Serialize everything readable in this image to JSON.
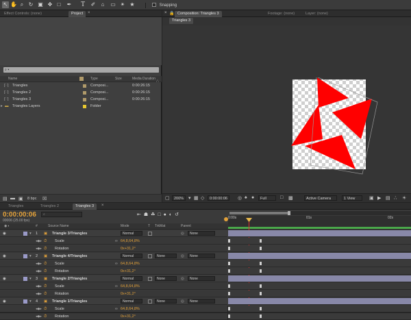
{
  "toolbar": {
    "tools": [
      "selection-tool",
      "hand-tool",
      "zoom-tool",
      "rotation-tool",
      "camera-tool",
      "pan-behind-tool",
      "rectangle-tool",
      "pen-tool",
      "text-tool",
      "brush-tool",
      "clone-stamp-tool",
      "eraser-tool",
      "roto-brush-tool",
      "puppet-tool"
    ],
    "snapping_label": "Snapping"
  },
  "left_panel": {
    "tabs": [
      "Effect Controls: (none)",
      "Project"
    ],
    "search_placeholder": "⌕ ▾",
    "columns": {
      "name": "Name",
      "type": "Type",
      "size": "Size",
      "media_duration": "Media Duration"
    },
    "items": [
      {
        "name": "Triangles",
        "type": "Composi...",
        "size": "",
        "duration": "0:00:26:15",
        "color": "#b09a6a",
        "kind": "comp"
      },
      {
        "name": "Triangles 2",
        "type": "Composi...",
        "size": "",
        "duration": "0:00:26:15",
        "color": "#b09a6a",
        "kind": "comp"
      },
      {
        "name": "Triangles 3",
        "type": "Composi...",
        "size": "",
        "duration": "0:00:26:15",
        "color": "#b09a6a",
        "kind": "comp"
      },
      {
        "name": "Triangles Layers",
        "type": "Folder",
        "size": "",
        "duration": "",
        "color": "#e8c830",
        "kind": "folder"
      }
    ],
    "bit_depth": "8 bpc"
  },
  "comp_panel": {
    "tabs": [
      "Composition: Triangles 3",
      "Footage: (none)",
      "Layer: (none)"
    ],
    "sub_tab": "Triangles 3",
    "zoom": "200%",
    "timecode": "0:00:00:06",
    "resolution": "Full",
    "camera": "Active Camera",
    "view": "1 View",
    "shape_color": "#ff0000"
  },
  "timeline": {
    "tabs": [
      "Triangles",
      "Triangles 2",
      "Triangles 3"
    ],
    "current_time": "0:00:00:06",
    "frame_info": "00006 (25.00 fps)",
    "headers": {
      "num": "#",
      "source_name": "Source Name",
      "mode": "Mode",
      "t": "T",
      "trkmat": "TrkMat",
      "parent": "Parent"
    },
    "ruler": [
      "0:00s",
      "01s",
      "02s"
    ],
    "layers": [
      {
        "num": "1",
        "name": "Triangle 3/Triangles",
        "mode": "Normal",
        "trkmat": "",
        "parent": "None",
        "scale": "64,8,64,8%",
        "rotation": "0x+31,2°"
      },
      {
        "num": "2",
        "name": "Triangle 4/Triangles",
        "mode": "Normal",
        "trkmat": "None",
        "parent": "None",
        "scale": "64,8,64,8%",
        "rotation": "0x+31,2°"
      },
      {
        "num": "3",
        "name": "Triangle 2/Triangles",
        "mode": "Normal",
        "trkmat": "None",
        "parent": "None",
        "scale": "64,8,64,8%",
        "rotation": "0x+31,2°"
      },
      {
        "num": "4",
        "name": "Triangle 1/Triangles",
        "mode": "Normal",
        "trkmat": "None",
        "parent": "None",
        "scale": "64,8,64,8%",
        "rotation": "0x+31,2°"
      }
    ],
    "prop_labels": {
      "scale": "Scale",
      "rotation": "Rotation"
    },
    "playhead_color": "#e03030",
    "layer_bar_color": "#8888a8"
  }
}
